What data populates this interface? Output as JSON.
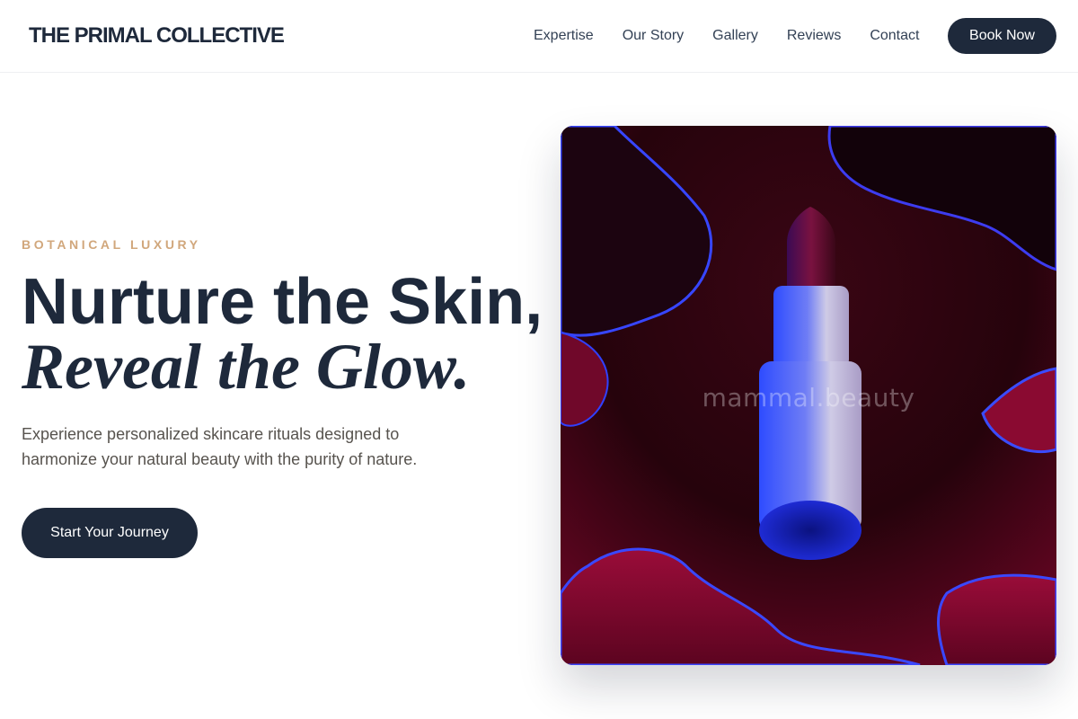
{
  "header": {
    "brand": "THE PRIMAL COLLECTIVE",
    "nav": [
      "Expertise",
      "Our Story",
      "Gallery",
      "Reviews",
      "Contact"
    ],
    "cta_label": "Book Now"
  },
  "hero": {
    "eyebrow": "BOTANICAL LUXURY",
    "headline_line1": "Nurture the Skin,",
    "headline_line2": "Reveal the Glow.",
    "subtext": "Experience personalized skincare rituals designed to harmonize your natural beauty with the purity of nature.",
    "cta_label": "Start Your Journey",
    "image": {
      "watermark": "mammal.beauty",
      "subject": "lipstick-on-red-gloss"
    }
  },
  "colors": {
    "primary": "#1e293b",
    "accent": "#d1a77c",
    "body_text": "#57534e",
    "background": "#ffffff"
  }
}
